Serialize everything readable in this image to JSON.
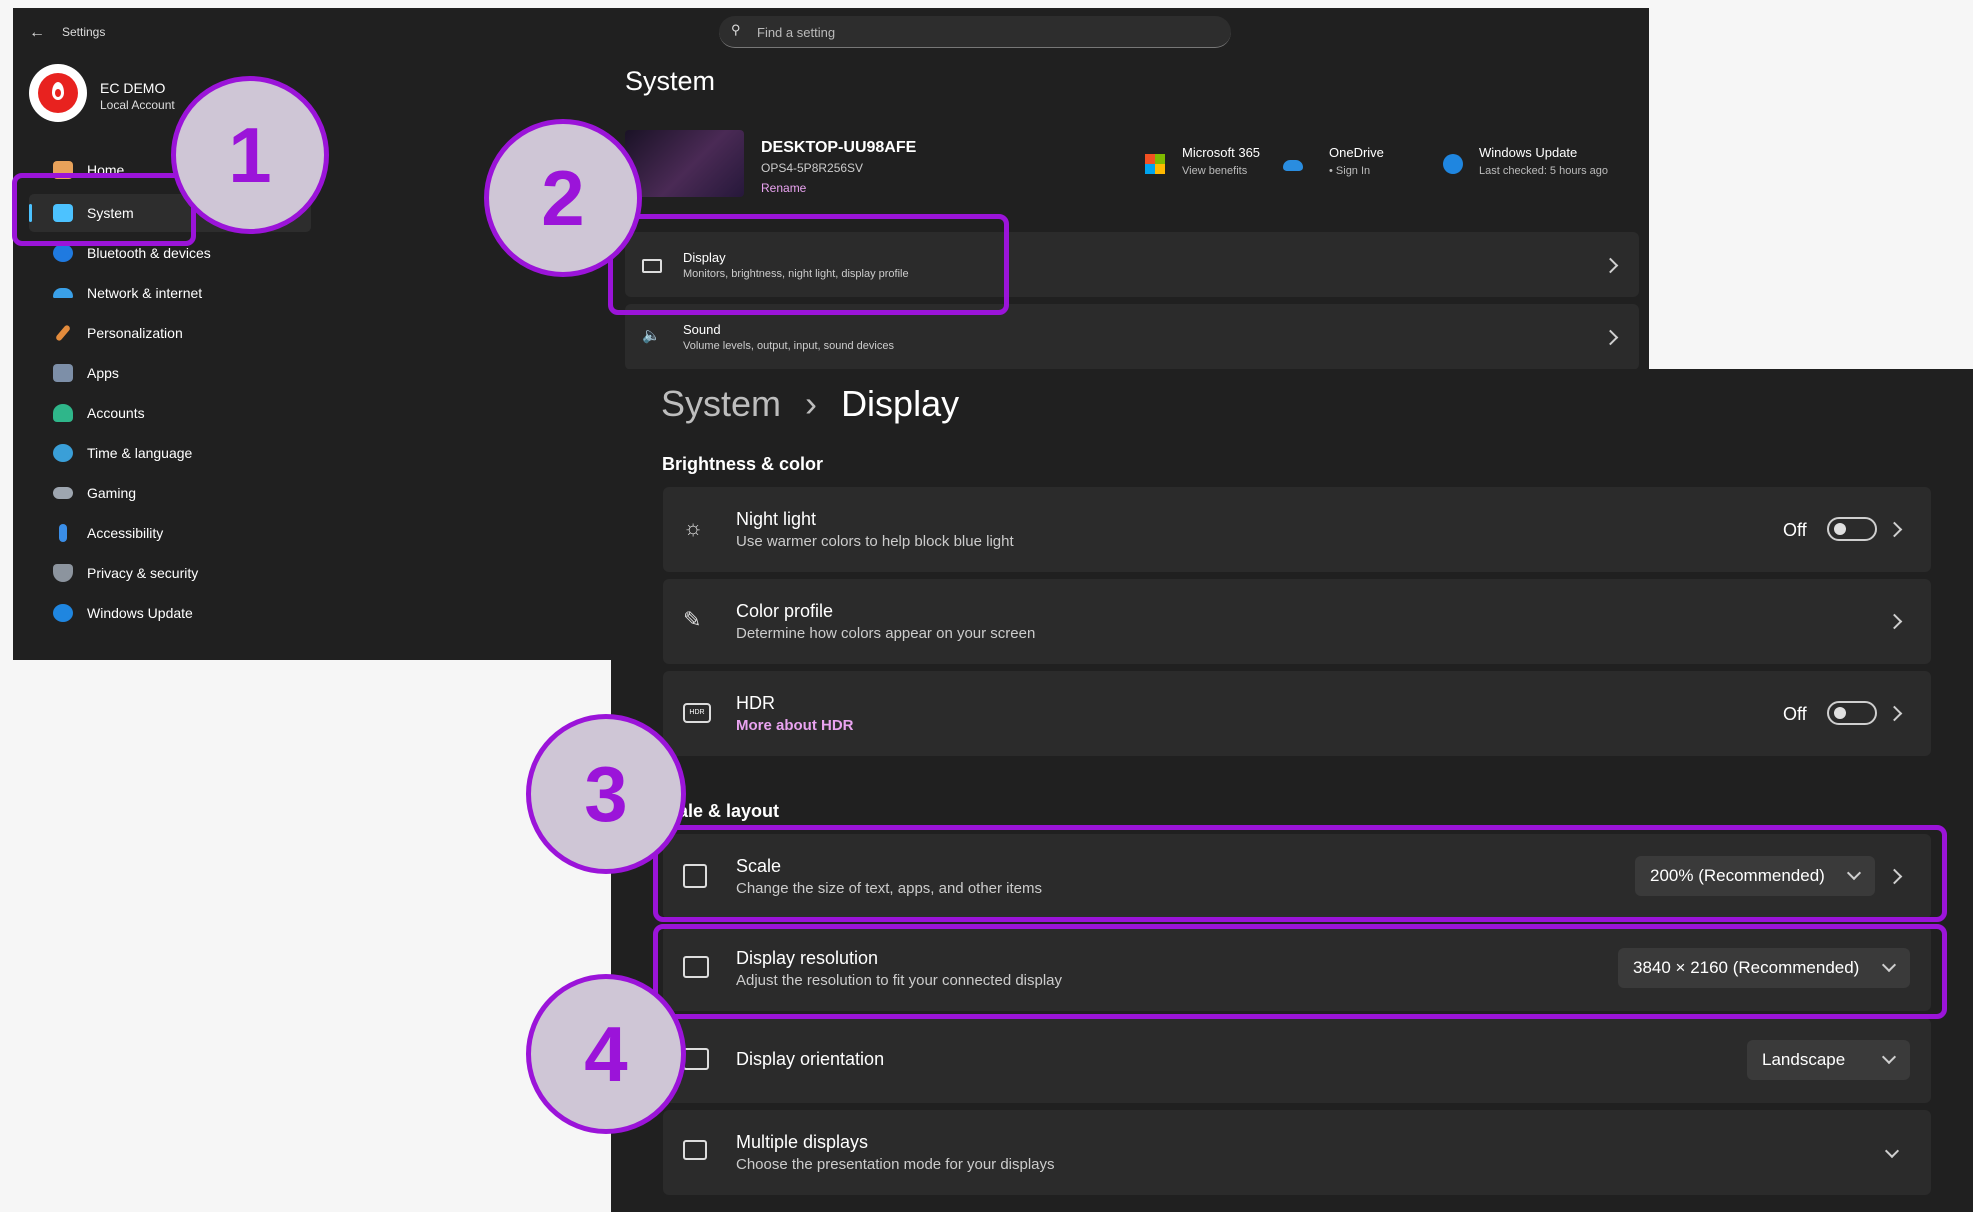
{
  "settings": {
    "app_title": "Settings",
    "search_placeholder": "Find a setting",
    "account": {
      "name": "EC DEMO",
      "type": "Local Account"
    },
    "sidebar": {
      "items": [
        {
          "label": "Home"
        },
        {
          "label": "System"
        },
        {
          "label": "Bluetooth & devices"
        },
        {
          "label": "Network & internet"
        },
        {
          "label": "Personalization"
        },
        {
          "label": "Apps"
        },
        {
          "label": "Accounts"
        },
        {
          "label": "Time & language"
        },
        {
          "label": "Gaming"
        },
        {
          "label": "Accessibility"
        },
        {
          "label": "Privacy & security"
        },
        {
          "label": "Windows Update"
        }
      ]
    },
    "page_title": "System",
    "device": {
      "name": "DESKTOP-UU98AFE",
      "model": "OPS4-5P8R256SV",
      "rename_label": "Rename"
    },
    "services": [
      {
        "title": "Microsoft 365",
        "subtitle": "View benefits"
      },
      {
        "title": "OneDrive",
        "subtitle": "• Sign In"
      },
      {
        "title": "Windows Update",
        "subtitle": "Last checked: 5 hours ago"
      }
    ],
    "rows": [
      {
        "title": "Display",
        "subtitle": "Monitors, brightness, night light, display profile"
      },
      {
        "title": "Sound",
        "subtitle": "Volume levels, output, input, sound devices"
      }
    ]
  },
  "display": {
    "breadcrumb_parent": "System",
    "breadcrumb_sep": "›",
    "breadcrumb_current": "Display",
    "section_brightness": "Brightness & color",
    "night_light": {
      "title": "Night light",
      "subtitle": "Use warmer colors to help block blue light",
      "state": "Off"
    },
    "color_profile": {
      "title": "Color profile",
      "subtitle": "Determine how colors appear on your screen"
    },
    "hdr": {
      "title": "HDR",
      "link": "More about HDR",
      "state": "Off"
    },
    "section_scale": "ale & layout",
    "scale": {
      "title": "Scale",
      "subtitle": "Change the size of text, apps, and other items",
      "value": "200% (Recommended)"
    },
    "resolution": {
      "title": "Display resolution",
      "subtitle": "Adjust the resolution to fit your connected display",
      "value": "3840 × 2160 (Recommended)"
    },
    "orientation": {
      "title": "Display orientation",
      "value": "Landscape"
    },
    "multiple": {
      "title": "Multiple displays",
      "subtitle": "Choose the presentation mode for your displays"
    }
  },
  "callouts": [
    "1",
    "2",
    "3",
    "4"
  ],
  "colors": {
    "accent": "#9b14d9",
    "link": "#e9a3f0",
    "panel": "#202020",
    "card": "#2b2b2b"
  }
}
